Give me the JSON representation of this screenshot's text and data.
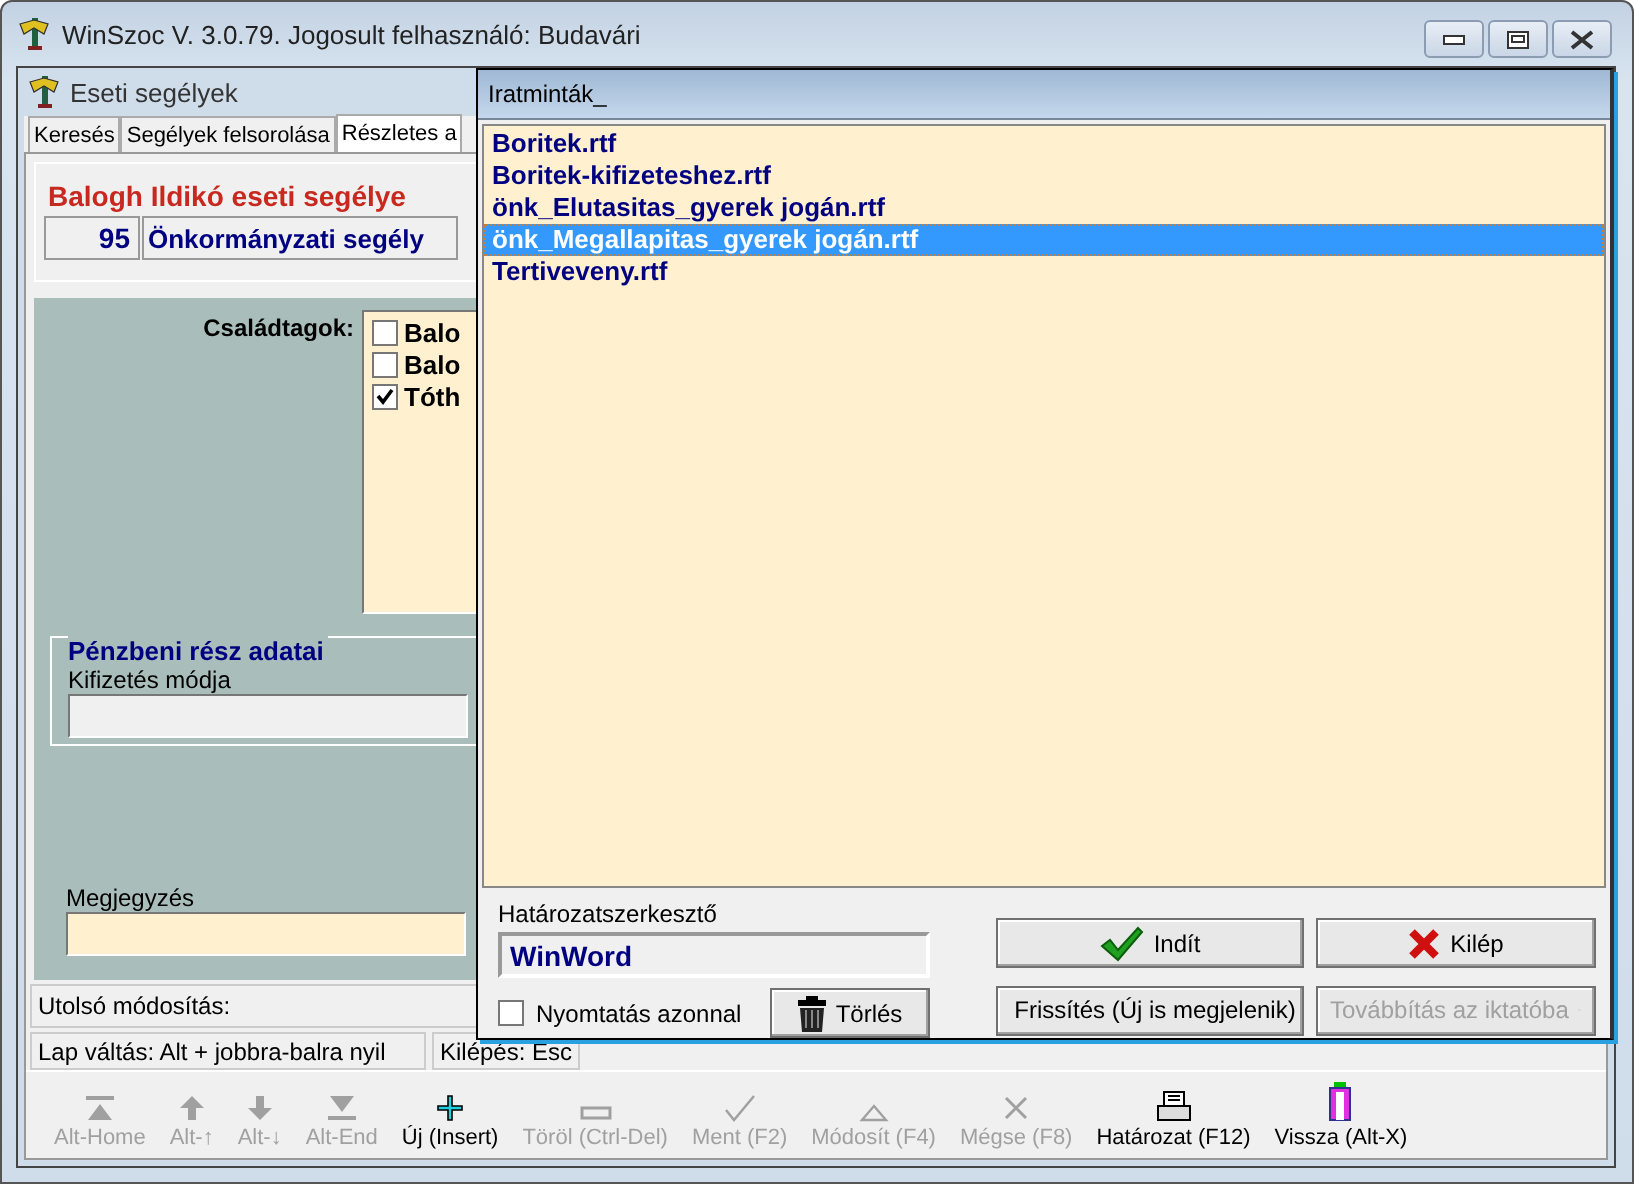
{
  "window": {
    "title": "WinSzoc V. 3.0.79. Jogosult felhasználó: Budavári"
  },
  "child_window": {
    "title": "Eseti segélyek",
    "tabs": [
      {
        "label": "Keresés",
        "selected": false
      },
      {
        "label": "Segélyek felsorolása",
        "selected": false
      },
      {
        "label": "Részletes a",
        "selected": true
      }
    ],
    "record": {
      "title": "Balogh Ildikó eseti segélye",
      "number": "95",
      "type": "Önkormányzati segély"
    },
    "family": {
      "label": "Családtagok:",
      "members": [
        {
          "name": "Balo",
          "checked": false
        },
        {
          "name": "Balo",
          "checked": false
        },
        {
          "name": "Tóth",
          "checked": true
        }
      ]
    },
    "payment": {
      "title": "Pénzbeni rész adatai",
      "method_label": "Kifizetés módja"
    },
    "note": {
      "label": "Megjegyzés"
    },
    "status": {
      "last_modified": "Utolsó módosítás:",
      "hint": "Lap váltás: Alt + jobbra-balra nyil",
      "exit": "Kilépés: Esc"
    }
  },
  "toolbar": [
    {
      "label": "Alt-Home",
      "kind": "first",
      "disabled": true
    },
    {
      "label": "Alt-↑",
      "kind": "up",
      "disabled": true
    },
    {
      "label": "Alt-↓",
      "kind": "down",
      "disabled": true
    },
    {
      "label": "Alt-End",
      "kind": "last",
      "disabled": true
    },
    {
      "label": "Új (Insert)",
      "kind": "new",
      "disabled": false
    },
    {
      "label": "Töröl (Ctrl-Del)",
      "kind": "delete",
      "disabled": true
    },
    {
      "label": "Ment (F2)",
      "kind": "save",
      "disabled": true
    },
    {
      "label": "Módosít (F4)",
      "kind": "edit",
      "disabled": true
    },
    {
      "label": "Mégse (F8)",
      "kind": "cancel",
      "disabled": true
    },
    {
      "label": "Határozat (F12)",
      "kind": "print",
      "disabled": false
    },
    {
      "label": "Vissza (Alt-X)",
      "kind": "exit",
      "disabled": false
    }
  ],
  "dialog": {
    "title": "Iratminták_",
    "files": [
      {
        "name": "Boritek.rtf",
        "selected": false
      },
      {
        "name": "Boritek-kifizeteshez.rtf",
        "selected": false
      },
      {
        "name": "önk_Elutasitas_gyerek jogán.rtf",
        "selected": false
      },
      {
        "name": "önk_Megallapitas_gyerek jogán.rtf",
        "selected": true
      },
      {
        "name": "Tertiveveny.rtf",
        "selected": false
      }
    ],
    "editor_label": "Határozatszerkesztő",
    "editor_value": "WinWord",
    "print_now": {
      "label": "Nyomtatás azonnal",
      "checked": false
    },
    "buttons": [
      {
        "label": "Indít",
        "kind": "start",
        "disabled": false
      },
      {
        "label": "Kilép",
        "kind": "quit",
        "disabled": false
      },
      {
        "label": "Törlés",
        "kind": "trash",
        "disabled": false
      },
      {
        "label": "Frissítés (Új is megjelenik)",
        "kind": "refresh",
        "disabled": false
      },
      {
        "label": "Továbbítás az iktatóba",
        "kind": "forward",
        "disabled": true
      }
    ]
  }
}
